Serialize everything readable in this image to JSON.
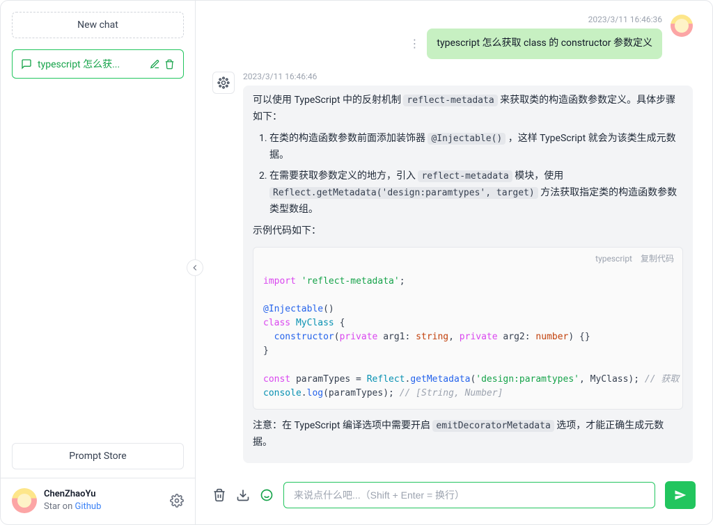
{
  "sidebar": {
    "new_chat": "New chat",
    "conversation": {
      "title": "typescript 怎么获..."
    },
    "prompt_store": "Prompt Store",
    "user": {
      "name": "ChenZhaoYu",
      "sub_prefix": "Star on ",
      "sub_link": "Github"
    }
  },
  "chat": {
    "user_msg": {
      "time": "2023/3/11 16:46:36",
      "text": "typescript 怎么获取 class 的 constructor 参数定义"
    },
    "ai_msg": {
      "time": "2023/3/11 16:46:46",
      "intro_a": "可以使用 TypeScript 中的反射机制 ",
      "intro_code": "reflect-metadata",
      "intro_b": " 来获取类的构造函数参数定义。具体步骤如下：",
      "step1_a": "在类的构造函数参数前面添加装饰器 ",
      "step1_code": "@Injectable()",
      "step1_b": " ，这样 TypeScript 就会为该类生成元数据。",
      "step2_a": "在需要获取参数定义的地方，引入 ",
      "step2_code1": "reflect-metadata",
      "step2_b": " 模块，使用 ",
      "step2_code2": "Reflect.getMetadata('design:paramtypes', target)",
      "step2_c": " 方法获取指定类的构造函数参数类型数组。",
      "example_label": "示例代码如下：",
      "code_lang": "typescript",
      "code_copy": "复制代码",
      "note_a": "注意：在 TypeScript 编译选项中需要开启 ",
      "note_code": "emitDecoratorMetadata",
      "note_b": " 选项，才能正确生成元数据。"
    }
  },
  "input": {
    "placeholder": "来说点什么吧...（Shift + Enter = 换行）"
  }
}
